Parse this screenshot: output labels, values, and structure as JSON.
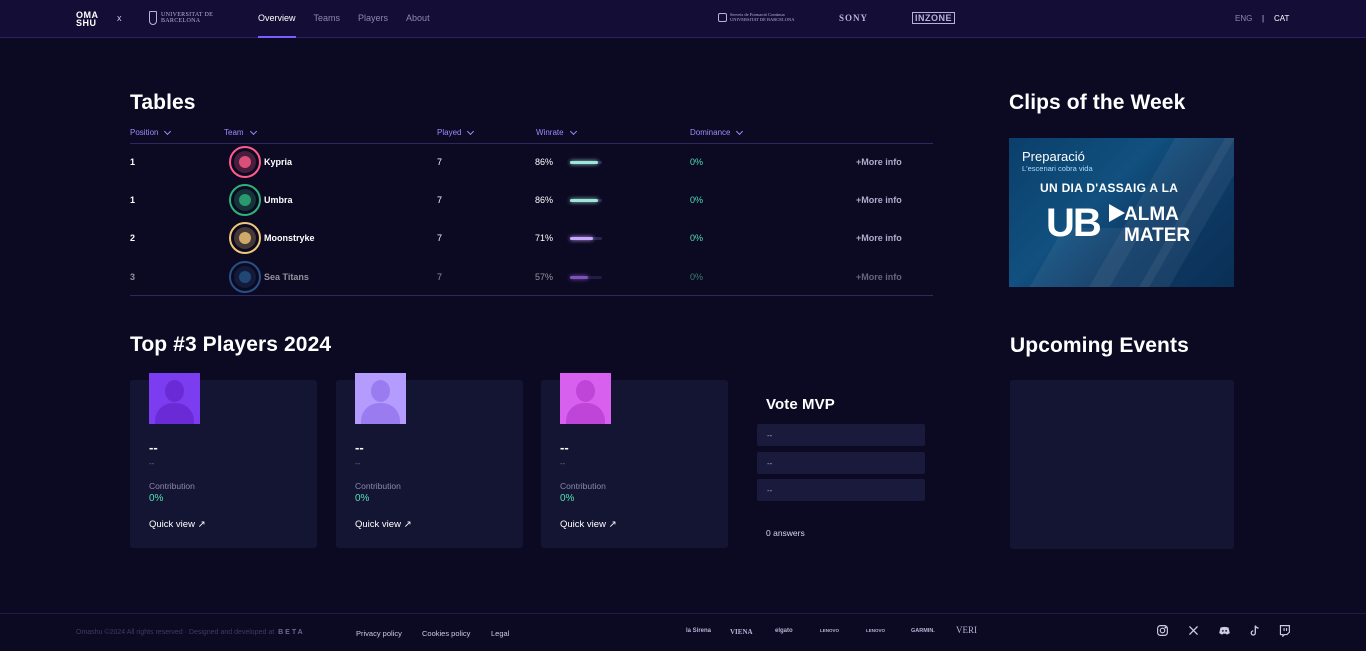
{
  "header": {
    "logo_omashu_line1": "OMA",
    "logo_omashu_line2": "SHU",
    "logo_separator": "x",
    "logo_ub_line1": "UNIVERSITAT DE",
    "logo_ub_line2": "BARCELONA",
    "nav": [
      "Overview",
      "Teams",
      "Players",
      "About"
    ],
    "active_nav": "Overview",
    "sponsor_tech_line1": "Serveis de Formació Continua",
    "sponsor_tech_line2": "UNIVERSITAT DE BARCELONA",
    "sponsor_sony": "SONY",
    "sponsor_inzone": "INZONE",
    "lang_eng": "ENG",
    "lang_separator": "|",
    "lang_cat": "CAT"
  },
  "tables": {
    "title": "Tables",
    "columns": [
      "Position",
      "Team",
      "Played",
      "Winrate",
      "Dominance"
    ],
    "rows": [
      {
        "position": "1",
        "team": "Kypria",
        "played": "7",
        "winrate": "86%",
        "winrate_value": 0.86,
        "dominance": "0%",
        "more": "+More info",
        "bar_color": "#9ee6dc",
        "badge_color": "#ff5c8a"
      },
      {
        "position": "1",
        "team": "Umbra",
        "played": "7",
        "winrate": "86%",
        "winrate_value": 0.86,
        "dominance": "0%",
        "more": "+More info",
        "bar_color": "#9ee6dc",
        "badge_color": "#2fb37a"
      },
      {
        "position": "2",
        "team": "Moonstryke",
        "played": "7",
        "winrate": "71%",
        "winrate_value": 0.71,
        "dominance": "0%",
        "more": "+More info",
        "bar_color": "#c8a8ff",
        "badge_color": "#f0c776"
      },
      {
        "position": "3",
        "team": "Sea Titans",
        "played": "7",
        "winrate": "57%",
        "winrate_value": 0.57,
        "dominance": "0%",
        "more": "+More info",
        "bar_color": "#b070ff",
        "badge_color": "#3a8fd6"
      }
    ]
  },
  "clips": {
    "title": "Clips of the Week",
    "video_title": "Preparació",
    "video_subtitle": "L'escenari cobra vida",
    "video_headline": "UN DIA D'ASSAIG A LA",
    "video_ub": "UB",
    "video_alma_line1": "ALMA",
    "video_alma_line2": "MATER"
  },
  "players": {
    "title": "Top #3 Players 2024",
    "cards": [
      {
        "name": "--",
        "sub": "--",
        "contribution_label": "Contribution",
        "contribution": "0%",
        "quick_view": "Quick view ↗",
        "avatar_bg": "#7c3cf0",
        "avatar_fg": "#6a2bd6"
      },
      {
        "name": "--",
        "sub": "--",
        "contribution_label": "Contribution",
        "contribution": "0%",
        "quick_view": "Quick view ↗",
        "avatar_bg": "#b49cff",
        "avatar_fg": "#9a7cf0"
      },
      {
        "name": "--",
        "sub": "--",
        "contribution_label": "Contribution",
        "contribution": "0%",
        "quick_view": "Quick view ↗",
        "avatar_bg": "#d860ee",
        "avatar_fg": "#bf45d8"
      }
    ]
  },
  "vote": {
    "title": "Vote MVP",
    "options": [
      "--",
      "--",
      "--"
    ],
    "answers": "0 answers"
  },
  "events": {
    "title": "Upcoming Events"
  },
  "footer": {
    "copyright": "Omashu ©2024 All rights reserved · Designed and developed at",
    "studio": "BETA",
    "links": [
      "Privacy policy",
      "Cookies policy",
      "Legal"
    ],
    "sponsors": [
      "la Sirena",
      "VIENA",
      "elgato",
      "LENOVO",
      "LENOVO",
      "GARMIN.",
      "VERI"
    ],
    "social_icons": [
      "instagram-icon",
      "x-icon",
      "discord-icon",
      "tiktok-icon",
      "twitch-icon"
    ]
  }
}
